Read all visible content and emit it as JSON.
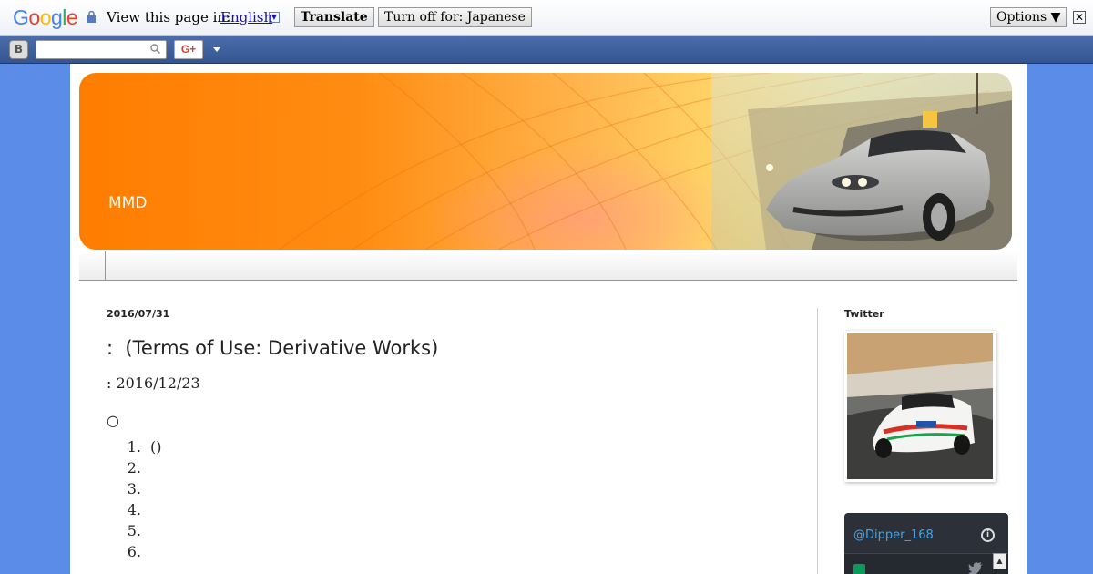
{
  "translate_bar": {
    "logo": "Google",
    "view_text": "View this page in:",
    "language": "English",
    "translate_label": "Translate",
    "turn_off_label": "Turn off for: Japanese",
    "options_label": "Options ▼",
    "close_glyph": "✕"
  },
  "navbar": {
    "logo_glyph": "B",
    "search_placeholder": "",
    "gplus_label": "G+"
  },
  "blog": {
    "title": "MMD"
  },
  "post": {
    "date": "2016/07/31",
    "title": ":  (Terms of Use: Derivative Works)",
    "updated": ": 2016/12/23",
    "bullet": "○",
    "list": [
      {
        "num": "1.",
        "text": "()"
      },
      {
        "num": "2.",
        "text": ""
      },
      {
        "num": "3.",
        "text": ""
      },
      {
        "num": "4.",
        "text": ""
      },
      {
        "num": "5.",
        "text": ""
      },
      {
        "num": "6.",
        "text": ""
      }
    ]
  },
  "sidebar": {
    "twitter_heading": "Twitter",
    "twitter_handle": "@Dipper_168",
    "info_glyph": "i",
    "scroll_up_glyph": "▲"
  },
  "colors": {
    "page_bg": "#5b8ce8",
    "accent_orange": "#ff7d00",
    "link_blue": "#1a0dab",
    "twitter_blue": "#4aa3e2"
  }
}
